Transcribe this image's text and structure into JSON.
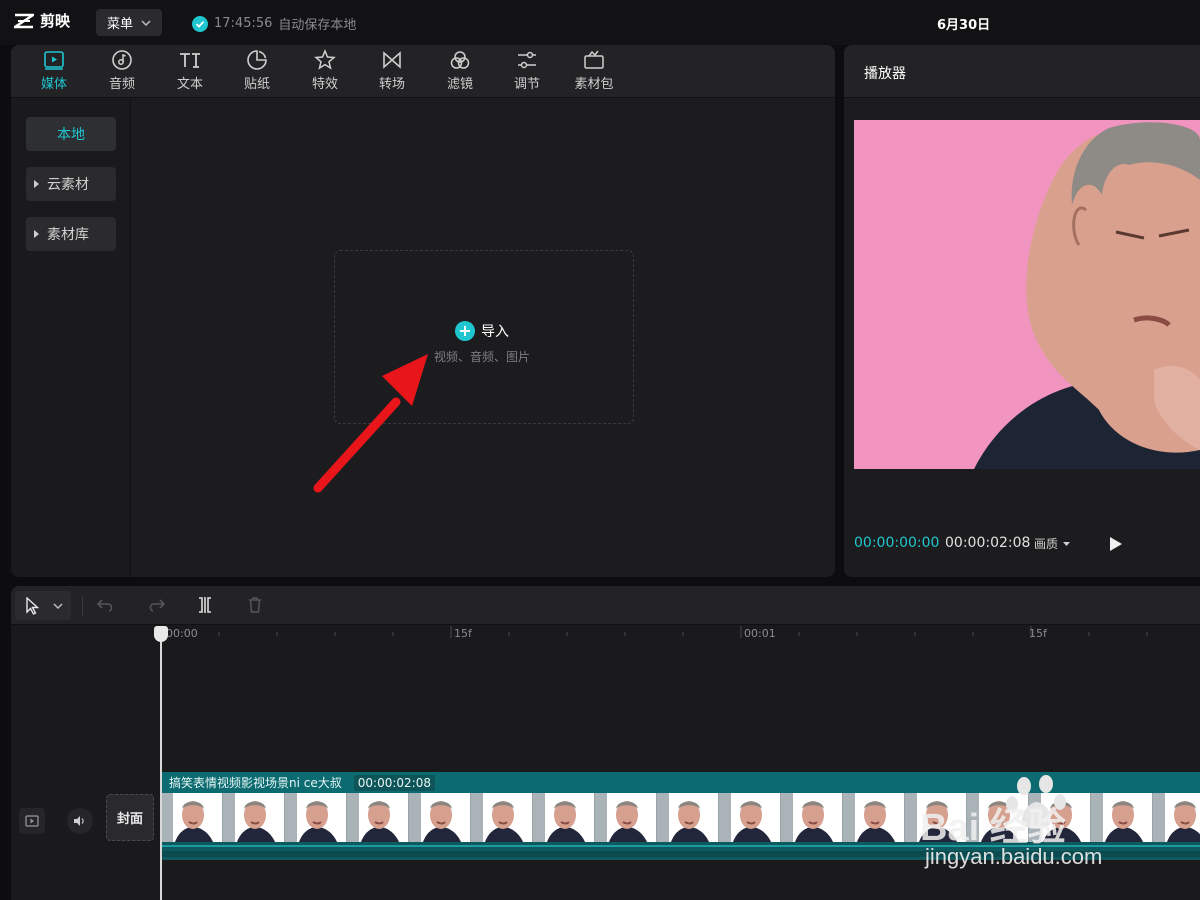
{
  "app": {
    "name": "剪映",
    "menu_label": "菜单",
    "save_time": "17:45:56",
    "save_text": "自动保存本地",
    "date": "6月30日"
  },
  "toolbar": [
    {
      "label": "媒体",
      "icon": "media-icon",
      "active": true
    },
    {
      "label": "音频",
      "icon": "audio-icon"
    },
    {
      "label": "文本",
      "icon": "text-icon"
    },
    {
      "label": "贴纸",
      "icon": "sticker-icon"
    },
    {
      "label": "特效",
      "icon": "effects-icon"
    },
    {
      "label": "转场",
      "icon": "transition-icon"
    },
    {
      "label": "滤镜",
      "icon": "filter-icon"
    },
    {
      "label": "调节",
      "icon": "adjust-icon"
    },
    {
      "label": "素材包",
      "icon": "material-pack-icon"
    }
  ],
  "sidebar": {
    "items": [
      "本地",
      "云素材",
      "素材库"
    ]
  },
  "import": {
    "label": "导入",
    "sub": "视频、音频、图片"
  },
  "player": {
    "title": "播放器",
    "current_time": "00:00:00:00",
    "total_time": "00:00:02:08",
    "quality_label": "画质"
  },
  "timeline": {
    "ticks": [
      "00:00",
      "15f",
      "00:01",
      "15f"
    ],
    "cover_label": "封面",
    "clip_name": "搞笑表情视频影视场景ni ce大叔",
    "clip_duration": "00:00:02:08"
  },
  "watermark": {
    "text": "Bai 经验",
    "url": "jingyan.baidu.com"
  },
  "colors": {
    "accent": "#1fc6d0",
    "preview_bg": "#f294c0",
    "clip": "#0b6b70",
    "arrow": "#e8151b"
  }
}
